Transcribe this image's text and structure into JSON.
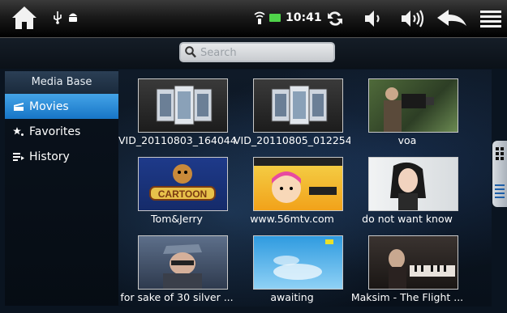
{
  "status": {
    "time": "10:41",
    "icons": [
      "home-icon",
      "usb-icon",
      "android-debug-icon",
      "wifi-icon",
      "battery-icon",
      "sync-icon",
      "volume-down-icon",
      "volume-up-icon",
      "back-icon",
      "menu-icon"
    ]
  },
  "search": {
    "placeholder": "Search"
  },
  "sidebar": {
    "header": "Media Base",
    "items": [
      {
        "label": "Movies",
        "icon": "movie-icon",
        "active": true
      },
      {
        "label": "Favorites",
        "icon": "star-icon",
        "active": false
      },
      {
        "label": "History",
        "icon": "history-icon",
        "active": false
      }
    ]
  },
  "videos": [
    {
      "title": "VID_20110803_164044",
      "thumb": "film-strip"
    },
    {
      "title": "VID_20110805_012254",
      "thumb": "film-strip"
    },
    {
      "title": "voa",
      "thumb": "cameraman"
    },
    {
      "title": "Tom&Jerry",
      "thumb": "cartoon"
    },
    {
      "title": "www.56mtv.com",
      "thumb": "anime"
    },
    {
      "title": "do not want know",
      "thumb": "portrait"
    },
    {
      "title": "for sake of 30 silver ...",
      "thumb": "man-cap"
    },
    {
      "title": "awaiting",
      "thumb": "sky"
    },
    {
      "title": "Maksim - The Flight ...",
      "thumb": "piano"
    }
  ]
}
